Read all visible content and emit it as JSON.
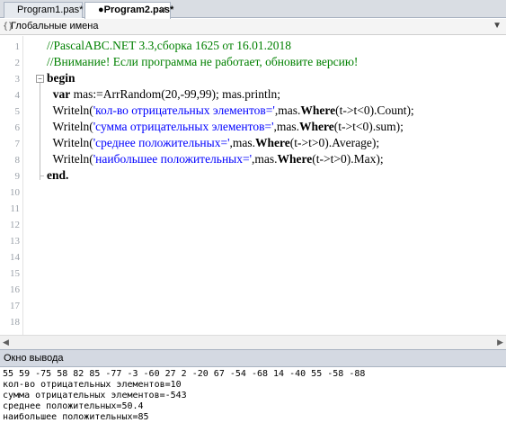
{
  "tabs": [
    {
      "label": "Program1.pas*",
      "active": false
    },
    {
      "label": "●Program2.pas*",
      "active": true
    }
  ],
  "scope": {
    "label": "Глобальные имена",
    "icon": "scope-braces-icon"
  },
  "editor": {
    "line_numbers": [
      "1",
      "2",
      "3",
      "4",
      "5",
      "6",
      "7",
      "8",
      "9",
      "10",
      "11",
      "12",
      "13",
      "14",
      "15",
      "16",
      "17",
      "18"
    ],
    "lines": [
      {
        "parts": [
          {
            "t": "//PascalABC.NET 3.3,сборка 1625 от 16.01.2018",
            "c": "comment"
          }
        ]
      },
      {
        "parts": [
          {
            "t": "//Внимание! Если программа не работает, обновите версию!",
            "c": "comment"
          }
        ]
      },
      {
        "parts": [
          {
            "t": "begin",
            "c": "kw"
          }
        ]
      },
      {
        "parts": [
          {
            "t": "  "
          },
          {
            "t": "var",
            "c": "kw"
          },
          {
            "t": " mas:=ArrRandom(20,-99,99); mas.println;"
          }
        ]
      },
      {
        "parts": [
          {
            "t": "  Writeln("
          },
          {
            "t": "'кол-во отрицательных элементов='",
            "c": "str"
          },
          {
            "t": ",mas."
          },
          {
            "t": "Where",
            "c": "method"
          },
          {
            "t": "(t->t<0).Count);"
          }
        ]
      },
      {
        "parts": [
          {
            "t": "  Writeln("
          },
          {
            "t": "'сумма отрицательных элементов='",
            "c": "str"
          },
          {
            "t": ",mas."
          },
          {
            "t": "Where",
            "c": "method"
          },
          {
            "t": "(t->t<0).sum);"
          }
        ]
      },
      {
        "parts": [
          {
            "t": "  Writeln("
          },
          {
            "t": "'среднее положительных='",
            "c": "str"
          },
          {
            "t": ",mas."
          },
          {
            "t": "Where",
            "c": "method"
          },
          {
            "t": "(t->t>0).Average);"
          }
        ]
      },
      {
        "parts": [
          {
            "t": "  Writeln("
          },
          {
            "t": "'наибольшее положительных='",
            "c": "str"
          },
          {
            "t": ",mas."
          },
          {
            "t": "Where",
            "c": "method"
          },
          {
            "t": "(t->t>0).Max);"
          }
        ]
      },
      {
        "parts": [
          {
            "t": "end.",
            "c": "kw"
          }
        ]
      }
    ]
  },
  "output": {
    "title": "Окно вывода",
    "lines": [
      "55 59 -75 58 82 85 -77 -3 -60 27 2 -20 67 -54 -68 14 -40 55 -58 -88",
      "кол-во отрицательных элементов=10",
      "сумма отрицательных элементов=-543",
      "среднее положительных=50.4",
      "наибольшее положительных=85"
    ]
  },
  "colors": {
    "comment": "#008000",
    "string": "#0000ff",
    "tab_bar": "#d9dde3",
    "output_header": "#d4d9e2"
  }
}
